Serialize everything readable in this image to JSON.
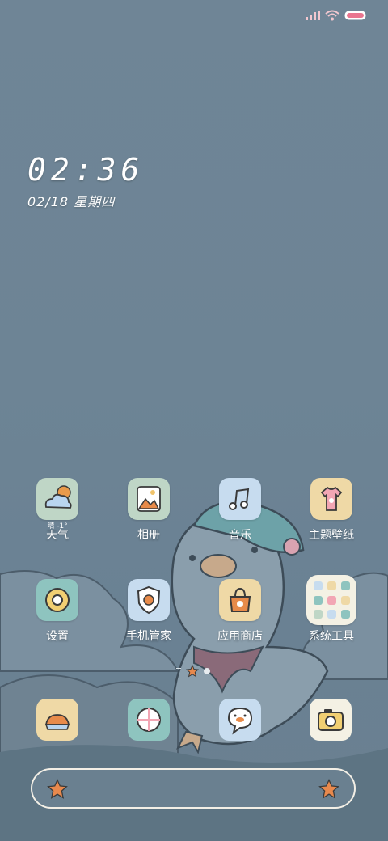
{
  "status_bar": {
    "signal_icon": "signal-bars-icon",
    "wifi_icon": "wifi-icon",
    "battery_icon": "battery-icon",
    "battery_color": "#e9758f"
  },
  "clock": {
    "time": "02:36",
    "date": "02/18 星期四"
  },
  "apps": [
    {
      "label": "天气",
      "icon": "weather-icon",
      "sublabel": "晴 -1°",
      "tile_color": "#bfd6c6"
    },
    {
      "label": "相册",
      "icon": "gallery-icon",
      "tile_color": "#bfd6c6"
    },
    {
      "label": "音乐",
      "icon": "music-icon",
      "tile_color": "#c7dcef"
    },
    {
      "label": "主题壁纸",
      "icon": "theme-shirt-icon",
      "tile_color": "#efd9a6"
    },
    {
      "label": "设置",
      "icon": "settings-gear-icon",
      "tile_color": "#8ec4bf"
    },
    {
      "label": "手机管家",
      "icon": "security-shield-icon",
      "tile_color": "#c7dcef"
    },
    {
      "label": "应用商店",
      "icon": "store-bag-icon",
      "tile_color": "#efd9a6"
    },
    {
      "label": "系统工具",
      "icon": "tools-folder-icon",
      "tile_color": "#f4f1e4"
    }
  ],
  "dock": [
    {
      "icon": "phone-duck-icon",
      "tile_color": "#efd9a6"
    },
    {
      "icon": "browser-duck-icon",
      "tile_color": "#8ec4bf"
    },
    {
      "icon": "messages-duck-icon",
      "tile_color": "#c7dcef"
    },
    {
      "icon": "camera-icon",
      "tile_color": "#f4f1e4"
    }
  ],
  "page_indicator": {
    "current": 2,
    "total": 3
  },
  "search_bar": {
    "left_icon": "star-flower-icon",
    "right_icon": "star-flower-icon",
    "accent": "#e8894d"
  }
}
